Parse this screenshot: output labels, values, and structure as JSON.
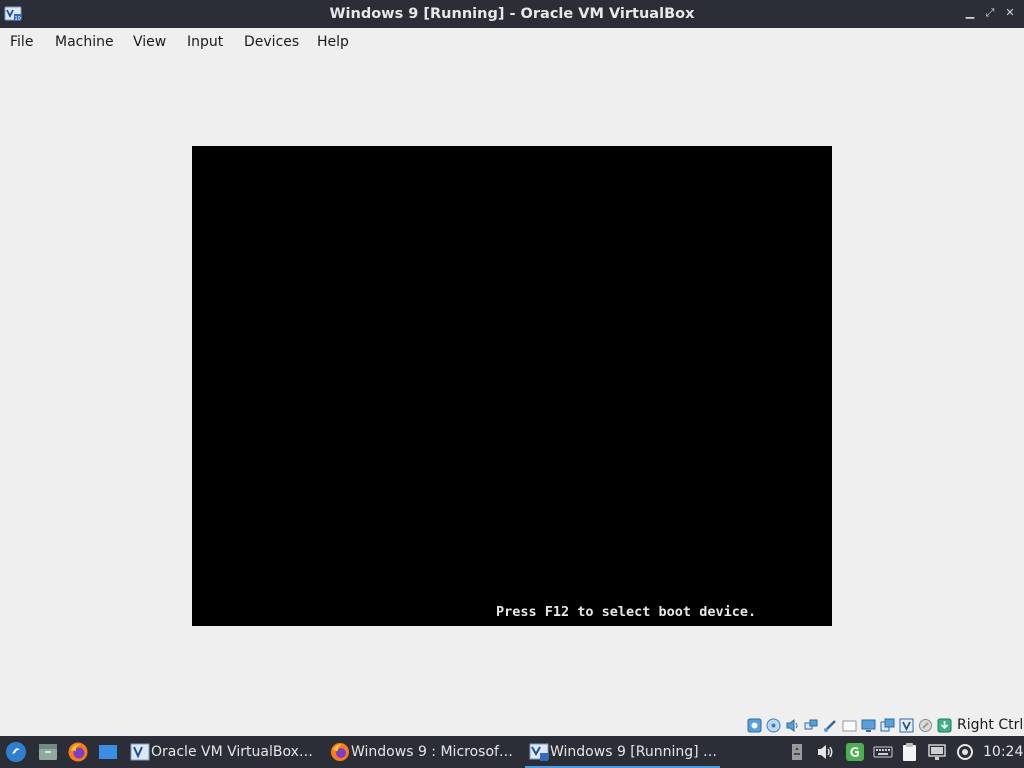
{
  "window": {
    "title": "Windows 9 [Running] - Oracle VM VirtualBox",
    "icon": "virtualbox-icon",
    "controls": [
      "minimize-icon",
      "maximize-icon",
      "close-icon"
    ]
  },
  "menubar": {
    "items": [
      "File",
      "Machine",
      "View",
      "Input",
      "Devices",
      "Help"
    ]
  },
  "vm_display": {
    "boot_message": "Press F12 to select boot device."
  },
  "statusbar": {
    "icons": [
      "hard-disk-icon",
      "optical-drive-icon",
      "audio-icon",
      "network-icon",
      "usb-icon",
      "shared-folders-icon",
      "display-icon",
      "video-capture-icon",
      "virtualization-icon",
      "mouse-integration-icon",
      "keyboard-capture-icon"
    ],
    "host_key": "Right Ctrl"
  },
  "taskbar": {
    "launchers": [
      "menu-icon",
      "files-icon",
      "firefox-icon",
      "show-desktop-icon"
    ],
    "tasks": [
      {
        "label": "Oracle VM VirtualBox…",
        "icon": "virtualbox-manager-icon",
        "active": false
      },
      {
        "label": "Windows 9 : Microsof…",
        "icon": "firefox-icon",
        "active": false
      },
      {
        "label": "Windows 9 [Running] …",
        "icon": "virtualbox-vm-icon",
        "active": true
      }
    ],
    "tray": [
      "removable-drive-icon",
      "volume-icon",
      "update-manager-icon",
      "keyboard-icon",
      "clipboard-icon",
      "network-icon",
      "power-icon"
    ],
    "clock": "10:24"
  }
}
